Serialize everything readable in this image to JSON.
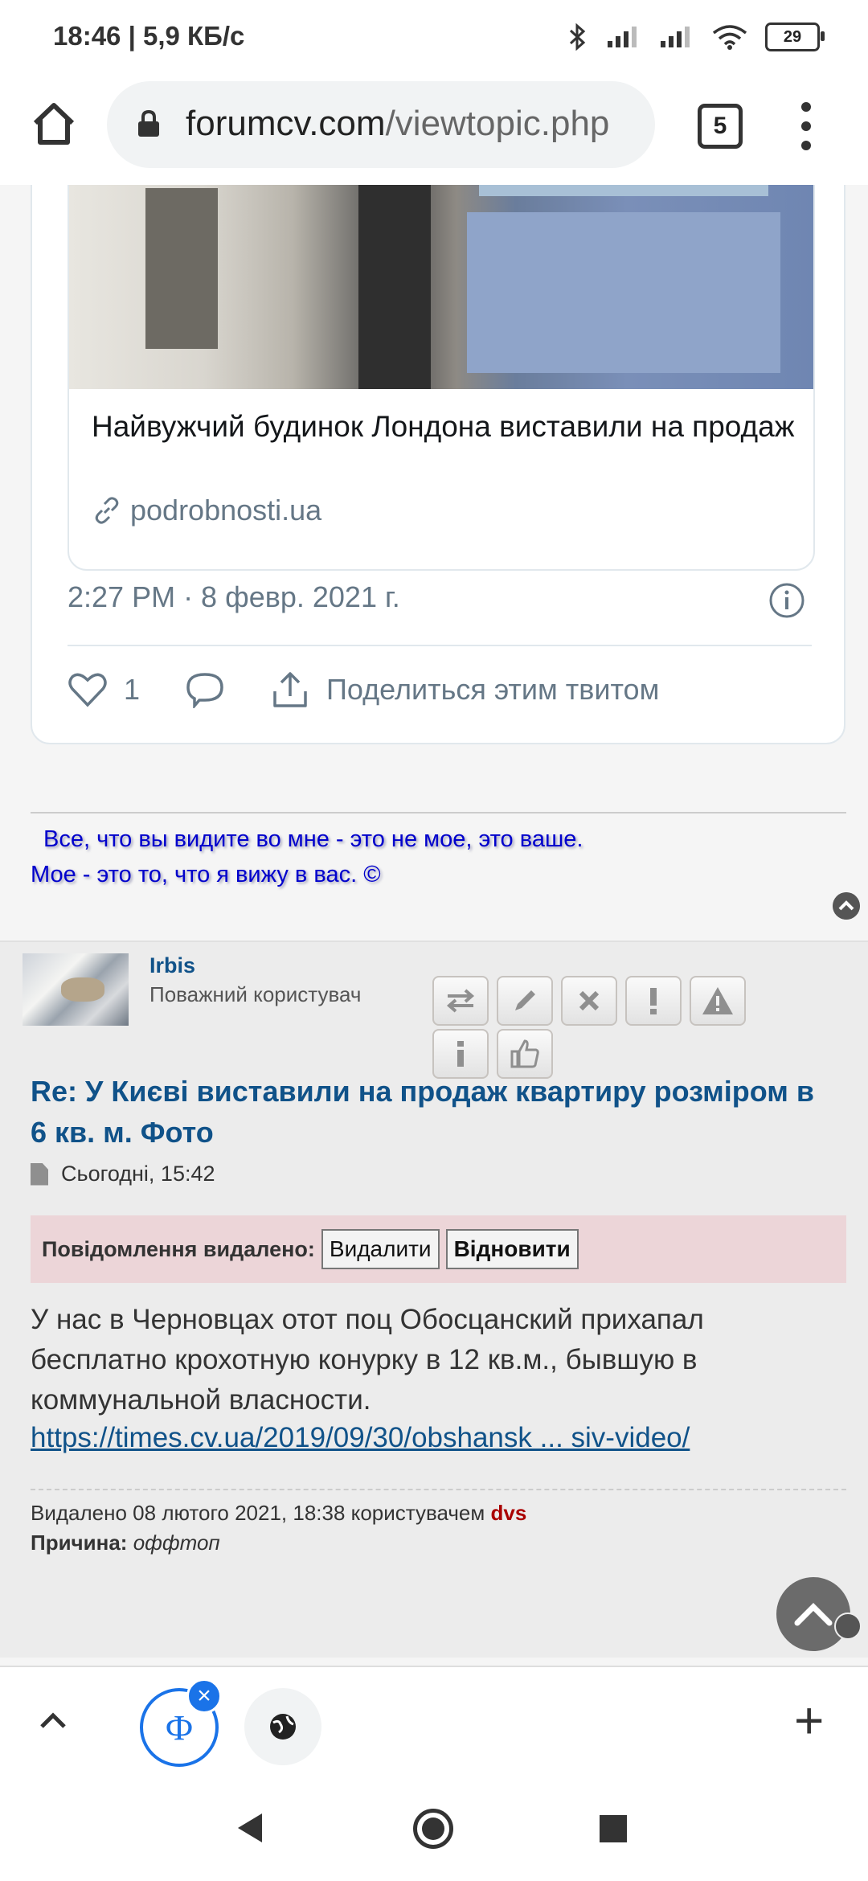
{
  "status_bar": {
    "time": "18:46 | 5,9 КБ/с",
    "battery": "29"
  },
  "browser": {
    "url_domain": "forumcv.com",
    "url_path": "/viewtopic.php",
    "tab_count": "5"
  },
  "tweet": {
    "preview_title": "Найвужчий будинок Лондона виставили на продаж",
    "preview_domain": "podrobnosti.ua",
    "time": "2:27 PM · 8 февр. 2021 г.",
    "likes": "1",
    "share_label": "Поделиться этим твитом"
  },
  "signature": {
    "line1": "Все, что вы видите во мне - это не мое, это ваше.",
    "line2": "Мое - это то, что я вижу в вас. ©"
  },
  "post": {
    "username": "Irbis",
    "rank": "Поважний користувач",
    "title": "Re: У Києві виставили на продаж квартиру розміром в 6 кв. м. Фото",
    "date": "Сьогодні, 15:42",
    "deleted_label": "Повідомлення видалено:",
    "delete_button": "Видалити",
    "restore_button": "Відновити",
    "body": "У нас в Черновцах отот поц Обосцанский прихапал бесплатно крохотную конурку в 12 кв.м., бывшую в коммунальной власности.",
    "link": "https://times.cv.ua/2019/09/30/obshansk ... siv-video/",
    "deleted_note": "Видалено 08 лютого 2021, 18:38 користувачем",
    "deleted_by": "dvs",
    "reason_label": "Причина:",
    "reason": "оффтоп"
  },
  "bottom_bar": {
    "tab1_glyph": "Ф",
    "close_glyph": "×",
    "plus": "+"
  }
}
